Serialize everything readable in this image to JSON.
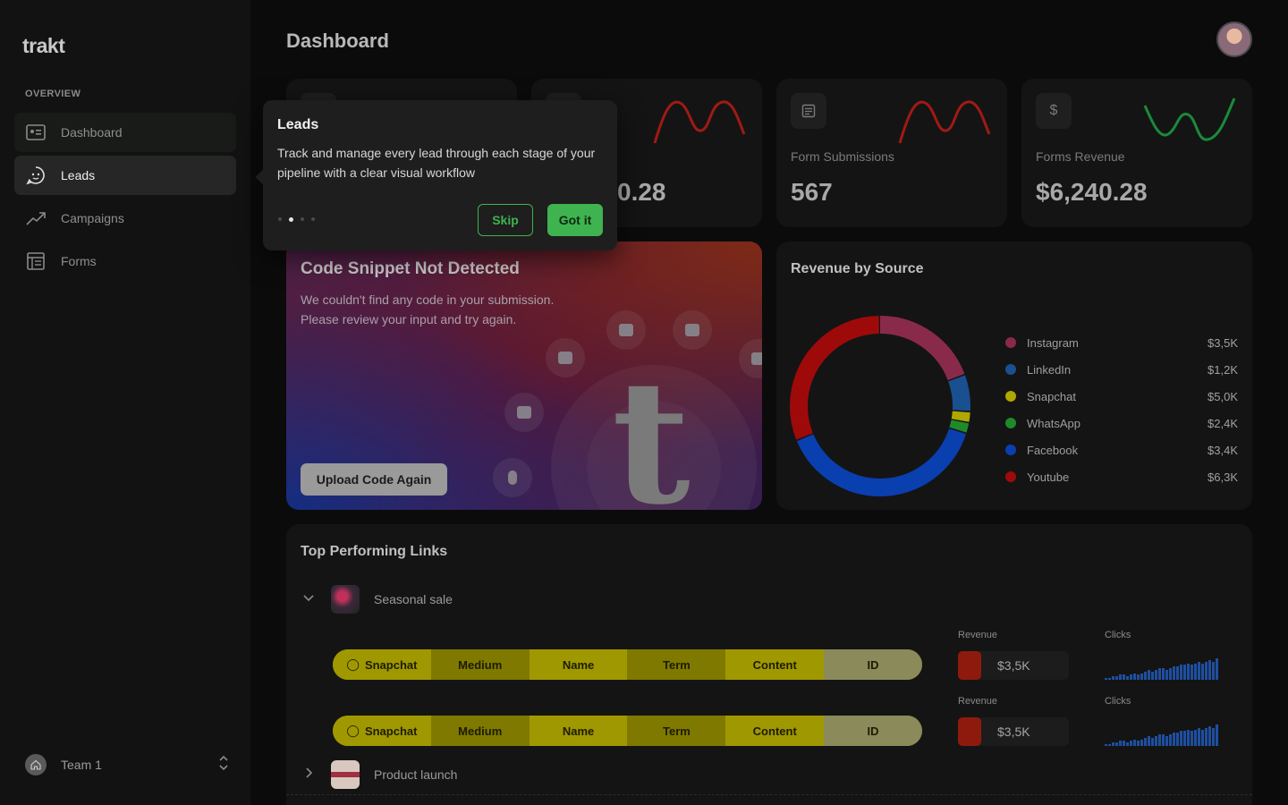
{
  "app": {
    "logo": "trakt"
  },
  "sidebar": {
    "section": "OVERVIEW",
    "items": [
      {
        "label": "Dashboard",
        "icon": "dashboard-icon"
      },
      {
        "label": "Leads",
        "icon": "leads-icon"
      },
      {
        "label": "Campaigns",
        "icon": "campaigns-icon"
      },
      {
        "label": "Forms",
        "icon": "forms-icon"
      }
    ],
    "team": "Team 1"
  },
  "header": {
    "title": "Dashboard"
  },
  "stats": [
    {
      "label": "",
      "value": ""
    },
    {
      "label": "",
      "value": "0.28"
    },
    {
      "label": "Form Submissions",
      "value": "567",
      "icon": "document-icon",
      "spark_color": "#a01a14"
    },
    {
      "label": "Forms Revenue",
      "value": "$6,240.28",
      "icon": "dollar-icon",
      "spark_color": "#1a8a3a"
    }
  ],
  "snippet": {
    "title": "Code Snippet Not Detected",
    "text": "We couldn't find any code in your submission. Please review your input and try again.",
    "button": "Upload Code Again",
    "mark": "t"
  },
  "revenue": {
    "title": "Revenue by Source",
    "sources": [
      {
        "name": "Instagram",
        "amount": "$3,5K",
        "value": 3.5,
        "color": "#8a2a4a"
      },
      {
        "name": "LinkedIn",
        "amount": "$1,2K",
        "value": 1.2,
        "color": "#1a4f90"
      },
      {
        "name": "Snapchat",
        "amount": "$5,0K",
        "value": 0.35,
        "color": "#b0a800"
      },
      {
        "name": "WhatsApp",
        "amount": "$2,4K",
        "value": 0.35,
        "color": "#1f8a2a"
      },
      {
        "name": "Facebook",
        "amount": "$3,4K",
        "value": 7.0,
        "color": "#0a3fb0"
      },
      {
        "name": "Youtube",
        "amount": "$6,3K",
        "value": 5.6,
        "color": "#9e0a0a"
      }
    ]
  },
  "links": {
    "title": "Top Performing Links",
    "groups": [
      {
        "name": "Seasonal sale"
      },
      {
        "name": "Product launch"
      }
    ],
    "utm": [
      "Snapchat",
      "Medium",
      "Name",
      "Term",
      "Content",
      "ID"
    ],
    "revenue_label": "Revenue",
    "clicks_label": "Clicks",
    "rows": [
      {
        "revenue": "$3,5K",
        "clicks": [
          1,
          1,
          2,
          2,
          3,
          3,
          2,
          3,
          4,
          3,
          4,
          5,
          6,
          5,
          6,
          7,
          7,
          6,
          7,
          8,
          8,
          9,
          9,
          10,
          9,
          10,
          11,
          10,
          11,
          12,
          11,
          13
        ]
      },
      {
        "revenue": "$3,5K",
        "clicks": [
          1,
          1,
          2,
          2,
          3,
          3,
          2,
          3,
          4,
          3,
          4,
          5,
          6,
          5,
          6,
          7,
          7,
          6,
          7,
          8,
          8,
          9,
          9,
          10,
          9,
          10,
          11,
          10,
          11,
          12,
          11,
          13
        ]
      }
    ]
  },
  "tooltip": {
    "title": "Leads",
    "text": "Track and manage every lead through each stage of your pipeline with a clear visual workflow",
    "skip": "Skip",
    "confirm": "Got it",
    "step": 2,
    "total": 4
  }
}
